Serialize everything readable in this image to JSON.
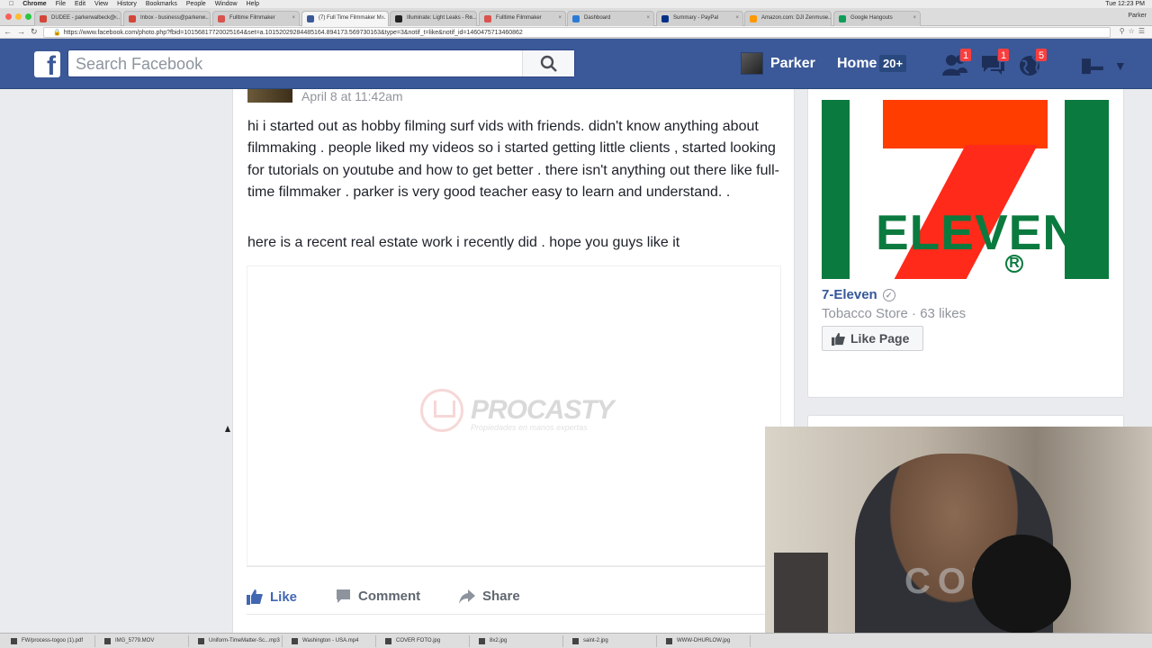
{
  "mac_menubar": {
    "app": "Chrome",
    "items": [
      "File",
      "Edit",
      "View",
      "History",
      "Bookmarks",
      "People",
      "Window",
      "Help"
    ],
    "clock": "Tue 12:23 PM"
  },
  "browser": {
    "tabs": [
      {
        "label": "DUDEE - parkerwalbeck@...",
        "color": "#d44638"
      },
      {
        "label": "Inbox - business@parkerw...",
        "color": "#d44638"
      },
      {
        "label": "Fulltime Filmmaker",
        "color": "#d9534f"
      },
      {
        "label": "(7) Full Time Filmmaker M...",
        "color": "#3b5998"
      },
      {
        "label": "Illuminate: Light Leaks - Ro...",
        "color": "#222222"
      },
      {
        "label": "Fulltime Filmmaker",
        "color": "#d9534f"
      },
      {
        "label": "Dashboard",
        "color": "#2b7bd6"
      },
      {
        "label": "Summary - PayPal",
        "color": "#003087"
      },
      {
        "label": "Amazon.com: DJI Zenmuse...",
        "color": "#ff9900"
      },
      {
        "label": "Google Hangouts",
        "color": "#0f9d58"
      }
    ],
    "profile": "Parker",
    "url": "https://www.facebook.com/photo.php?fbid=10156817720025164&set=a.10152029284485164.894173.569730163&type=3&notif_t=like&notif_id=1460475713460862"
  },
  "facebook": {
    "search_placeholder": "Search Facebook",
    "user_name": "Parker",
    "home_label": "Home",
    "home_count": "20+",
    "badges": {
      "friends": "1",
      "messages": "1",
      "notifications": "5"
    }
  },
  "post": {
    "date": "April 8 at 11:42am",
    "text_1": "hi i started out as hobby filming surf vids with friends. didn't know anything about filmmaking . people liked my videos so i started getting little clients , started looking for tutorials on youtube and how to get better . there isn't anything out there like full-time filmmaker . parker is very good teacher easy to learn and understand. .",
    "text_2": "here is a recent real estate work i recently did . hope you guys like it",
    "watermark_brand": "PROCASTY",
    "watermark_tagline": "Propiedades en manos expertas",
    "actions": {
      "like": "Like",
      "comment": "Comment",
      "share": "Share"
    }
  },
  "page_card": {
    "logo_text": "ELEVEN",
    "name": "7-Eleven",
    "meta": "Tobacco Store · 63 likes",
    "like_button": "Like Page"
  },
  "webcam": {
    "shirt_text": "COT"
  },
  "taskbar": {
    "items": [
      "FW/process-togoo (1).pdf",
      "IMG_5779.MOV",
      "Uniform-TimeMatter-Sc...mp3",
      "Washington - USA.mp4",
      "COVER FOTO.jpg",
      "8x2.jpg",
      "saint-2.jpg",
      "WWW-DHURLOW.jpg"
    ]
  }
}
